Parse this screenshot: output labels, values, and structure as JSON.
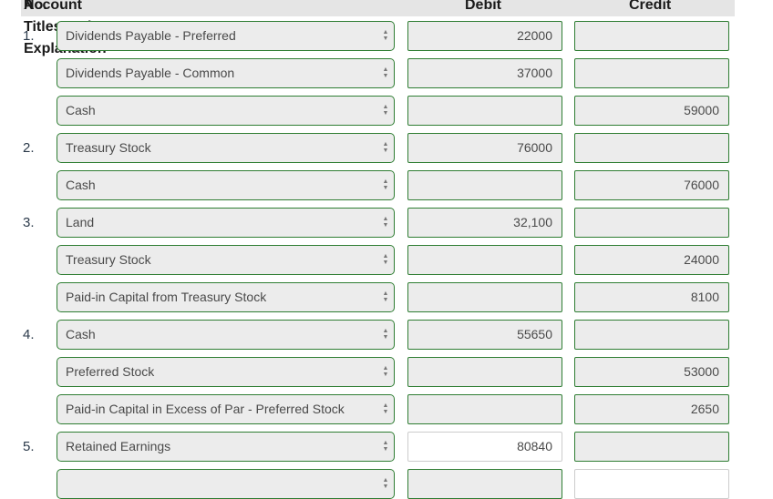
{
  "header": {
    "no_label": "No.",
    "account_label": "Account Titles and Explanation",
    "debit_label": "Debit",
    "credit_label": "Credit"
  },
  "icons": {
    "select_arrows": "sort-up-down-icon"
  },
  "rows": [
    {
      "no": "1.",
      "account": "Dividends Payable - Preferred",
      "debit": "22000",
      "credit": ""
    },
    {
      "no": "",
      "account": "Dividends Payable - Common",
      "debit": "37000",
      "credit": ""
    },
    {
      "no": "",
      "account": "Cash",
      "debit": "",
      "credit": "59000"
    },
    {
      "no": "2.",
      "account": "Treasury Stock",
      "debit": "76000",
      "credit": ""
    },
    {
      "no": "",
      "account": "Cash",
      "debit": "",
      "credit": "76000"
    },
    {
      "no": "3.",
      "account": "Land",
      "debit": "32,100",
      "credit": ""
    },
    {
      "no": "",
      "account": "Treasury Stock",
      "debit": "",
      "credit": "24000"
    },
    {
      "no": "",
      "account": "Paid-in Capital from Treasury Stock",
      "debit": "",
      "credit": "8100"
    },
    {
      "no": "4.",
      "account": "Cash",
      "debit": "55650",
      "credit": ""
    },
    {
      "no": "",
      "account": "Preferred Stock",
      "debit": "",
      "credit": "53000"
    },
    {
      "no": "",
      "account": "Paid-in Capital in Excess of Par - Preferred Stock",
      "debit": "",
      "credit": "2650"
    },
    {
      "no": "5.",
      "account": "Retained Earnings",
      "debit": "80840",
      "credit": ""
    },
    {
      "no": "",
      "account": "",
      "debit": "",
      "credit": ""
    }
  ]
}
